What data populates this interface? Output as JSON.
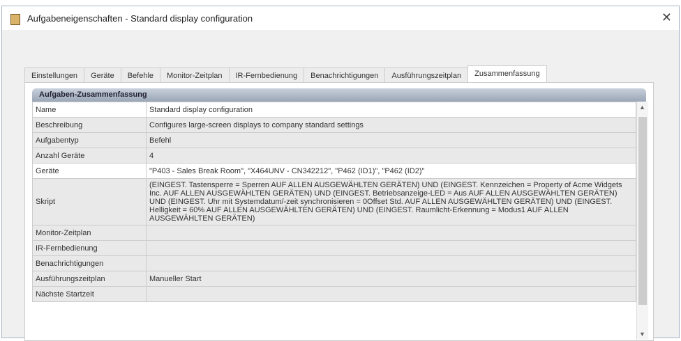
{
  "window": {
    "title": "Aufgabeneigenschaften - Standard display configuration",
    "close": "✕"
  },
  "tabs": [
    "Einstellungen",
    "Geräte",
    "Befehle",
    "Monitor-Zeitplan",
    "IR-Fernbedienung",
    "Benachrichtigungen",
    "Ausführungszeitplan",
    "Zusammenfassung"
  ],
  "panel": {
    "title": "Aufgaben-Zusammenfassung"
  },
  "rows": [
    {
      "label": "Name",
      "value": "Standard display configuration"
    },
    {
      "label": "Beschreibung",
      "value": "Configures large-screen displays to company standard settings"
    },
    {
      "label": "Aufgabentyp",
      "value": "Befehl"
    },
    {
      "label": "Anzahl Geräte",
      "value": "4"
    },
    {
      "label": "Geräte",
      "value": "\"P403 - Sales Break Room\",  \"X464UNV - CN342212\",  \"P462 (ID1)\",  \"P462 (ID2)\""
    },
    {
      "label": "Skript",
      "value": "(EINGEST. Tastensperre = Sperren AUF ALLEN AUSGEWÄHLTEN GERÄTEN) UND (EINGEST. Kennzeichen = Property of Acme Widgets Inc. AUF ALLEN AUSGEWÄHLTEN GERÄTEN) UND (EINGEST. Betriebsanzeige-LED = Aus AUF ALLEN AUSGEWÄHLTEN GERÄTEN) UND (EINGEST. Uhr mit Systemdatum/-zeit synchronisieren = 0Offset Std. AUF ALLEN AUSGEWÄHLTEN GERÄTEN) UND (EINGEST. Helligkeit = 60% AUF ALLEN AUSGEWÄHLTEN GERÄTEN) UND (EINGEST. Raumlicht-Erkennung = Modus1 AUF ALLEN AUSGEWÄHLTEN GERÄTEN)"
    },
    {
      "label": "Monitor-Zeitplan",
      "value": ""
    },
    {
      "label": "IR-Fernbedienung",
      "value": ""
    },
    {
      "label": "Benachrichtigungen",
      "value": ""
    },
    {
      "label": "Ausführungszeitplan",
      "value": "Manueller Start"
    },
    {
      "label": "Nächste Startzeit",
      "value": ""
    }
  ]
}
